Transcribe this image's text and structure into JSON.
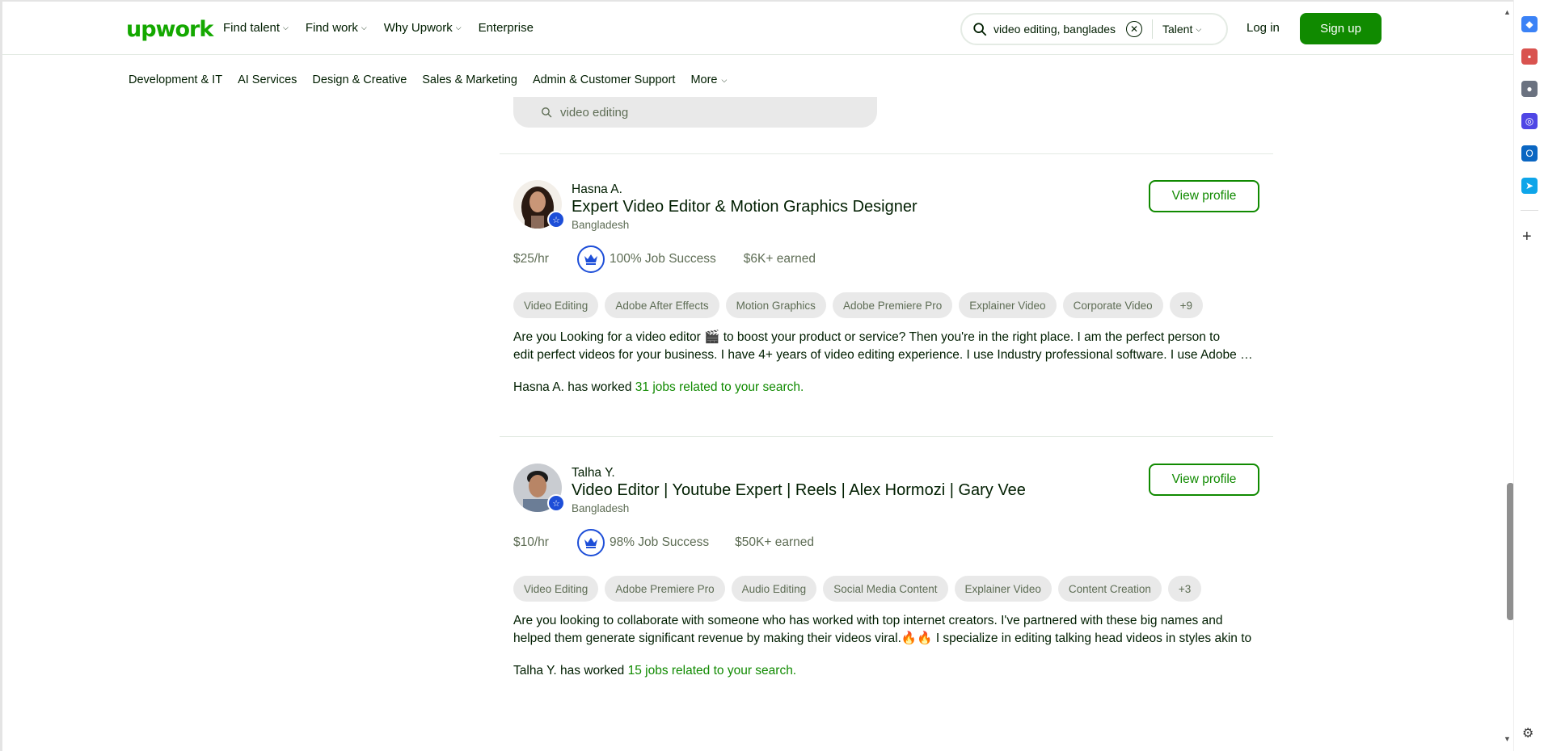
{
  "header": {
    "logo": "upwork",
    "nav": [
      "Find talent",
      "Find work",
      "Why Upwork",
      "Enterprise"
    ],
    "search": {
      "value": "video editing, banglades",
      "scope": "Talent"
    },
    "login": "Log in",
    "signup": "Sign up"
  },
  "subnav": [
    "Development & IT",
    "AI Services",
    "Design & Creative",
    "Sales & Marketing",
    "Admin & Customer Support",
    "More"
  ],
  "inner_search": {
    "placeholder": "video editing"
  },
  "freelancers": [
    {
      "name": "Hasna A.",
      "title": "Expert Video Editor & Motion Graphics Designer",
      "country": "Bangladesh",
      "view_label": "View profile",
      "rate": "$25/hr",
      "job_success": "100% Job Success",
      "earned": "$6K+ earned",
      "skills": [
        "Video Editing",
        "Adobe After Effects",
        "Motion Graphics",
        "Adobe Premiere Pro",
        "Explainer Video",
        "Corporate Video",
        "+9"
      ],
      "desc_line1": "Are you Looking for a video editor 🎬 to boost your product or service? Then you're in the right place. I am the perfect person to",
      "desc_line2": "edit perfect videos for your business. I have 4+ years of video editing experience. I use Industry professional software. I use Adobe Premiere Pro",
      "worked_prefix": "Hasna A. has worked ",
      "worked_link": "31 jobs related to your search."
    },
    {
      "name": "Talha Y.",
      "title": "Video Editor | Youtube Expert | Reels | Alex Hormozi | Gary Vee",
      "country": "Bangladesh",
      "view_label": "View profile",
      "rate": "$10/hr",
      "job_success": "98% Job Success",
      "earned": "$50K+ earned",
      "skills": [
        "Video Editing",
        "Adobe Premiere Pro",
        "Audio Editing",
        "Social Media Content",
        "Explainer Video",
        "Content Creation",
        "+3"
      ],
      "desc_line1": "Are you looking to collaborate with someone who has worked with top internet creators. I've partnered with these big names and",
      "desc_line2": "helped them generate significant revenue by making their videos viral.🔥🔥 I specialize in editing talking head videos in styles akin to",
      "worked_prefix": "Talha Y. has worked ",
      "worked_link": "15 jobs related to your search."
    }
  ],
  "colors": {
    "brand_green": "#14a800",
    "button_green": "#108a00",
    "badge_blue": "#1d4ed8"
  }
}
